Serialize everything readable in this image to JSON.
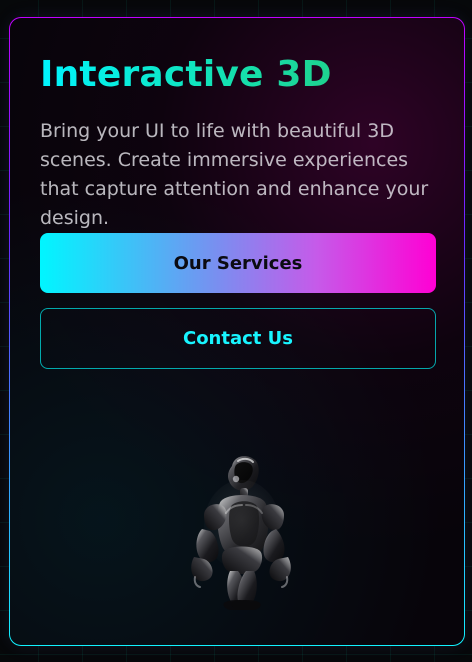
{
  "hero": {
    "title": "Interactive 3D",
    "description": "Bring your UI to life with beautiful 3D scenes. Create immersive experiences that capture attention and enhance your design.",
    "buttons": {
      "primary_label": "Our Services",
      "secondary_label": "Contact Us"
    }
  },
  "colors": {
    "accent_cyan": "#00f6ff",
    "accent_magenta": "#ff00d4",
    "card_border_top": "#c000ff",
    "card_border_bottom": "#11f3ff"
  },
  "icons": {
    "robot": "robot-icon"
  }
}
